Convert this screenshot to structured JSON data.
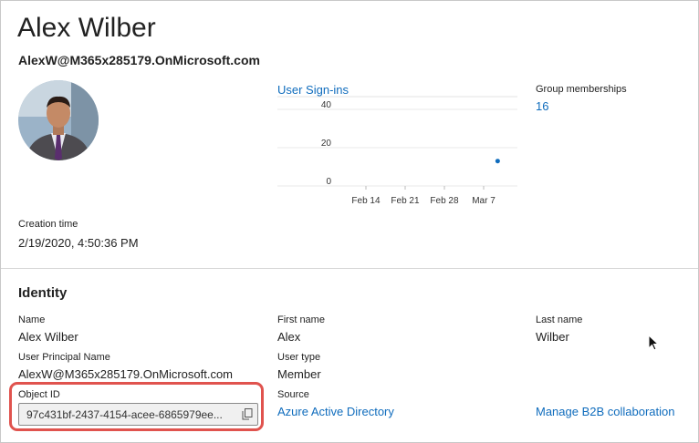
{
  "header": {
    "display_name": "Alex Wilber",
    "principal_name": "AlexW@M365x285179.OnMicrosoft.com"
  },
  "sign_ins": {
    "title": "User Sign-ins",
    "chart_data": {
      "type": "scatter",
      "title": "User Sign-ins",
      "xlabel": "",
      "ylabel": "",
      "x_tick_labels": [
        "Feb 14",
        "Feb 21",
        "Feb 28",
        "Mar 7"
      ],
      "y_ticks": [
        0,
        20,
        40
      ],
      "ylim": [
        0,
        40
      ],
      "grid": true,
      "points": [
        {
          "x": "Mar 8",
          "y": 13
        }
      ],
      "color": "#0f6cbd"
    }
  },
  "groups": {
    "label": "Group memberships",
    "value": "16"
  },
  "creation": {
    "label": "Creation time",
    "value": "2/19/2020, 4:50:36 PM"
  },
  "identity": {
    "title": "Identity",
    "name_label": "Name",
    "name_value": "Alex Wilber",
    "first_name_label": "First name",
    "first_name_value": "Alex",
    "last_name_label": "Last name",
    "last_name_value": "Wilber",
    "upn_label": "User Principal Name",
    "upn_value": "AlexW@M365x285179.OnMicrosoft.com",
    "user_type_label": "User type",
    "user_type_value": "Member",
    "object_id_label": "Object ID",
    "object_id_value": "97c431bf-2437-4154-acee-6865979ee...",
    "source_label": "Source",
    "source_value": "Azure Active Directory",
    "b2b_link": "Manage B2B collaboration"
  },
  "colors": {
    "link": "#0f6cbd",
    "highlight": "#e0534e"
  },
  "icons": {
    "copy": "copy-icon",
    "cursor": "mouse-pointer-icon"
  }
}
